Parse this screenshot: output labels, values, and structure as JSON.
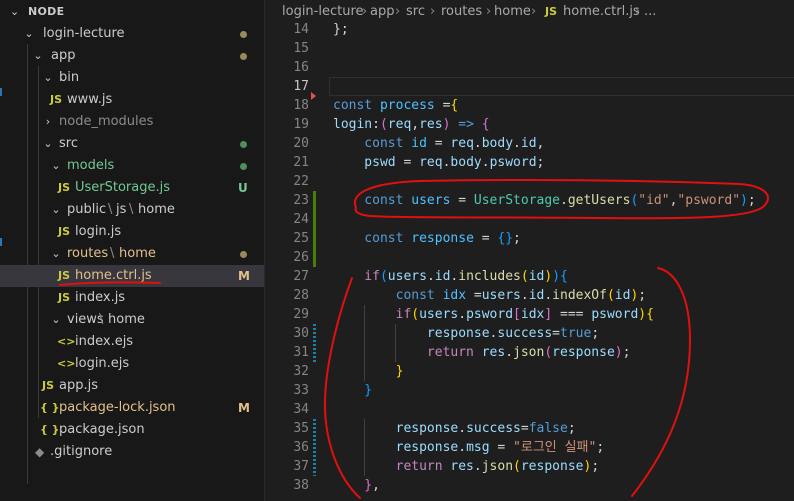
{
  "explorer": {
    "title": "NODE",
    "items": [
      {
        "label": "login-lecture",
        "badge": ""
      },
      {
        "label": "app",
        "badge": ""
      },
      {
        "label": "bin",
        "badge": ""
      },
      {
        "label": "www.js",
        "badge": ""
      },
      {
        "label": "node_modules",
        "badge": ""
      },
      {
        "label": "src",
        "badge": ""
      },
      {
        "label": "models",
        "badge": ""
      },
      {
        "label": "UserStorage.js",
        "badge": "U"
      },
      {
        "label": "public",
        "label2": "js",
        "label3": "home",
        "badge": ""
      },
      {
        "label": "login.js",
        "badge": ""
      },
      {
        "label": "routes",
        "label2": "home",
        "badge": ""
      },
      {
        "label": "home.ctrl.js",
        "badge": "M"
      },
      {
        "label": "index.js",
        "badge": ""
      },
      {
        "label": "views",
        "label2": "home",
        "badge": ""
      },
      {
        "label": "index.ejs",
        "badge": ""
      },
      {
        "label": "login.ejs",
        "badge": ""
      },
      {
        "label": "app.js",
        "badge": ""
      },
      {
        "label": "package-lock.json",
        "badge": "M"
      },
      {
        "label": "package.json",
        "badge": ""
      },
      {
        "label": ".gitignore",
        "badge": ""
      }
    ],
    "path_separator": "\\",
    "icons": {
      "js": "JS",
      "json": "{ }",
      "ejs": "<>",
      "git": "◆"
    }
  },
  "breadcrumb": {
    "items": [
      "login-lecture",
      "app",
      "src",
      "routes",
      "home",
      "home.ctrl.js",
      "..."
    ],
    "file_icon": "JS"
  },
  "editor": {
    "current_line": 17,
    "line_numbers": [
      14,
      15,
      16,
      17,
      18,
      19,
      20,
      21,
      22,
      23,
      24,
      25,
      26,
      27,
      28,
      29,
      30,
      31,
      32,
      33,
      34,
      35,
      36,
      37,
      38
    ],
    "lines": [
      [
        [
          "};",
          "p"
        ]
      ],
      [],
      [],
      [],
      [
        [
          "const ",
          "k"
        ],
        [
          "process",
          "c"
        ],
        [
          " =",
          "p"
        ],
        [
          "{",
          "y"
        ]
      ],
      [
        [
          "login",
          "v"
        ],
        [
          ":",
          "p"
        ],
        [
          "(",
          "mg"
        ],
        [
          "req",
          "v"
        ],
        [
          ",",
          "p"
        ],
        [
          "res",
          "v"
        ],
        [
          ")",
          "mg"
        ],
        [
          " => ",
          "k"
        ],
        [
          "{",
          "mg"
        ]
      ],
      [
        [
          "    const ",
          "k"
        ],
        [
          "id",
          "c"
        ],
        [
          " = ",
          "p"
        ],
        [
          "req",
          "v"
        ],
        [
          ".",
          "p"
        ],
        [
          "body",
          "v"
        ],
        [
          ".",
          "p"
        ],
        [
          "id",
          "v"
        ],
        [
          ",",
          "p"
        ]
      ],
      [
        [
          "    pswd",
          "v"
        ],
        [
          " = ",
          "p"
        ],
        [
          "req",
          "v"
        ],
        [
          ".",
          "p"
        ],
        [
          "body",
          "v"
        ],
        [
          ".",
          "p"
        ],
        [
          "psword",
          "v"
        ],
        [
          ";",
          "p"
        ]
      ],
      [],
      [
        [
          "    const ",
          "k"
        ],
        [
          "users",
          "c"
        ],
        [
          " = ",
          "p"
        ],
        [
          "UserStorage",
          "t"
        ],
        [
          ".",
          "p"
        ],
        [
          "getUsers",
          "f"
        ],
        [
          "(",
          "bl"
        ],
        [
          "\"id\"",
          "s"
        ],
        [
          ",",
          "p"
        ],
        [
          "\"psword\"",
          "s"
        ],
        [
          ")",
          "bl"
        ],
        [
          ";",
          "p"
        ]
      ],
      [],
      [
        [
          "    const ",
          "k"
        ],
        [
          "response",
          "c"
        ],
        [
          " = ",
          "p"
        ],
        [
          "{}",
          "bl"
        ],
        [
          ";",
          "p"
        ]
      ],
      [],
      [
        [
          "    if",
          "kc"
        ],
        [
          "(",
          "bl"
        ],
        [
          "users",
          "v"
        ],
        [
          ".",
          "p"
        ],
        [
          "id",
          "v"
        ],
        [
          ".",
          "p"
        ],
        [
          "includes",
          "f"
        ],
        [
          "(",
          "y"
        ],
        [
          "id",
          "v"
        ],
        [
          ")",
          "y"
        ],
        [
          ")",
          "bl"
        ],
        [
          "{",
          "bl"
        ]
      ],
      [
        [
          "        const ",
          "k"
        ],
        [
          "idx",
          "c"
        ],
        [
          " =",
          "p"
        ],
        [
          "users",
          "v"
        ],
        [
          ".",
          "p"
        ],
        [
          "id",
          "v"
        ],
        [
          ".",
          "p"
        ],
        [
          "indexOf",
          "f"
        ],
        [
          "(",
          "y"
        ],
        [
          "id",
          "v"
        ],
        [
          ")",
          "y"
        ],
        [
          ";",
          "p"
        ]
      ],
      [
        [
          "        if",
          "kc"
        ],
        [
          "(",
          "y"
        ],
        [
          "users",
          "v"
        ],
        [
          ".",
          "p"
        ],
        [
          "psword",
          "v"
        ],
        [
          "[",
          "mg"
        ],
        [
          "idx",
          "v"
        ],
        [
          "]",
          "mg"
        ],
        [
          " === ",
          "p"
        ],
        [
          "psword",
          "v"
        ],
        [
          ")",
          "y"
        ],
        [
          "{",
          "y"
        ]
      ],
      [
        [
          "            response",
          "v"
        ],
        [
          ".",
          "p"
        ],
        [
          "success",
          "v"
        ],
        [
          "=",
          "p"
        ],
        [
          "true",
          "k"
        ],
        [
          ";",
          "p"
        ]
      ],
      [
        [
          "            return ",
          "kc"
        ],
        [
          "res",
          "v"
        ],
        [
          ".",
          "p"
        ],
        [
          "json",
          "f"
        ],
        [
          "(",
          "mg"
        ],
        [
          "response",
          "v"
        ],
        [
          ")",
          "mg"
        ],
        [
          ";",
          "p"
        ]
      ],
      [
        [
          "        }",
          "y"
        ]
      ],
      [
        [
          "    }",
          "bl"
        ]
      ],
      [],
      [
        [
          "        response",
          "v"
        ],
        [
          ".",
          "p"
        ],
        [
          "success",
          "v"
        ],
        [
          "=",
          "p"
        ],
        [
          "false",
          "k"
        ],
        [
          ";",
          "p"
        ]
      ],
      [
        [
          "        response",
          "v"
        ],
        [
          ".",
          "p"
        ],
        [
          "msg",
          "v"
        ],
        [
          " = ",
          "p"
        ],
        [
          "\"로그인 실패\"",
          "s"
        ],
        [
          ";",
          "p"
        ]
      ],
      [
        [
          "        return ",
          "kc"
        ],
        [
          "res",
          "v"
        ],
        [
          ".",
          "p"
        ],
        [
          "json",
          "f"
        ],
        [
          "(",
          "y"
        ],
        [
          "response",
          "v"
        ],
        [
          ")",
          "y"
        ],
        [
          ";",
          "p"
        ]
      ],
      [
        [
          "    }",
          "mg"
        ],
        [
          ",",
          "p"
        ]
      ]
    ]
  },
  "colors": {
    "background": "#1e1e1e",
    "sidebar": "#181818",
    "selection": "#37373d",
    "annotation": "#e01010",
    "modified": "#e2c08d",
    "untracked": "#73c991"
  }
}
